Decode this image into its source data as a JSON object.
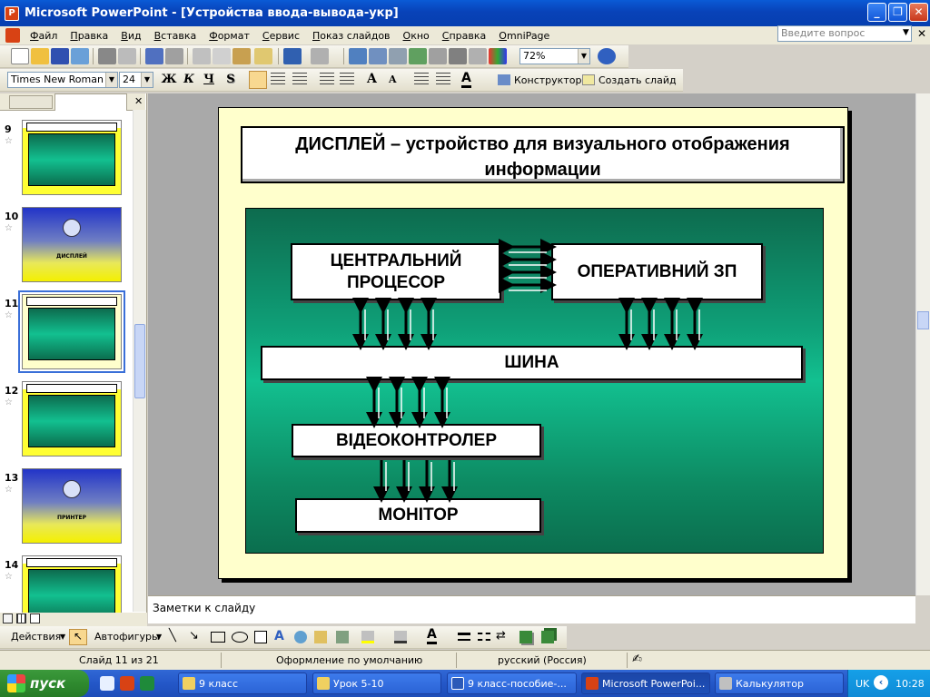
{
  "window": {
    "title": "Microsoft PowerPoint - [Устройства ввода-вывода-укр]",
    "app_icon": "powerpoint-icon"
  },
  "menu": {
    "items": [
      "Файл",
      "Правка",
      "Вид",
      "Вставка",
      "Формат",
      "Сервис",
      "Показ слайдов",
      "Окно",
      "Справка",
      "OmniPage"
    ],
    "help_placeholder": "Введите вопрос"
  },
  "standard_toolbar": {
    "zoom": "72%"
  },
  "format_toolbar": {
    "font": "Times New Roman",
    "size": "24",
    "bold": "Ж",
    "italic": "К",
    "underline": "Ч",
    "shadow": "S",
    "designer_label": "Конструктор",
    "new_slide_label": "Создать слайд"
  },
  "thumbnails": [
    {
      "num": "9",
      "style": "green-blue",
      "label": ""
    },
    {
      "num": "10",
      "style": "blue-yellow",
      "label": "ДИСПЛЕЙ"
    },
    {
      "num": "11",
      "style": "green-blue",
      "label": "",
      "selected": true
    },
    {
      "num": "12",
      "style": "green-blue",
      "label": ""
    },
    {
      "num": "13",
      "style": "blue-yellow",
      "label": "ПРИНТЕР"
    },
    {
      "num": "14",
      "style": "green-blue",
      "label": ""
    }
  ],
  "slide": {
    "title": "ДИСПЛЕЙ – устройство для визуального отображения информации",
    "cpu": "ЦЕНТРАЛЬНИЙ ПРОЦЕСОР",
    "ram": "ОПЕРАТИВНИЙ ЗП",
    "bus": "ШИНА",
    "video": "ВІДЕОКОНТРОЛЕР",
    "monitor": "МОНІТОР"
  },
  "notes": {
    "placeholder": "Заметки к слайду"
  },
  "drawing_toolbar": {
    "actions": "Действия",
    "autoshapes": "Автофигуры"
  },
  "status": {
    "slide": "Слайд 11 из 21",
    "design": "Оформление по умолчанию",
    "language": "русский (Россия)"
  },
  "taskbar": {
    "start": "пуск",
    "tasks": [
      "9 класс",
      "Урок  5-10",
      "9 класс-пособие-...",
      "Microsoft PowerPoi...",
      "Калькулятор"
    ],
    "lang": "UK",
    "time": "10:28"
  }
}
